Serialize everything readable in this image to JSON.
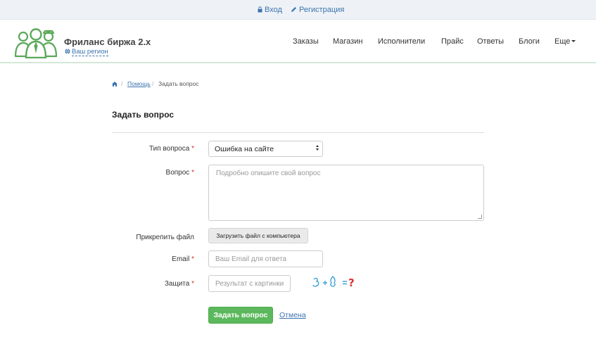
{
  "topbar": {
    "login": "Вход",
    "register": "Регистрация"
  },
  "header": {
    "brand": "Фриланс биржа 2.x",
    "region": "Ваш регион",
    "nav": [
      "Заказы",
      "Магазин",
      "Исполнители",
      "Прайс",
      "Ответы",
      "Блоги",
      "Еще"
    ]
  },
  "breadcrumb": {
    "help": "Помощь",
    "sep": "/",
    "current": "Задать вопрос"
  },
  "form": {
    "title": "Задать вопрос",
    "required_mark": "*",
    "type_label": "Тип вопроса",
    "type_value": "Ошибка на сайте",
    "question_label": "Вопрос",
    "question_placeholder": "Подробно опишите свой вопрос",
    "file_label": "Прикрепить файл",
    "file_button": "Загрузить файл с компьютера",
    "email_label": "Email",
    "email_placeholder": "Ваш Email для ответа",
    "captcha_label": "Защита",
    "captcha_placeholder": "Результат с картинки",
    "submit": "Задать вопрос",
    "cancel": "Отмена"
  },
  "icons": {
    "login": "lock-icon",
    "register": "pencil-icon",
    "region": "globe-icon",
    "home": "home-icon"
  },
  "colors": {
    "link": "#3b73af",
    "primary_button": "#5cb85c",
    "required": "#c9302c",
    "topbar_bg": "#eef2f6",
    "logo_green": "#5aa85a"
  }
}
